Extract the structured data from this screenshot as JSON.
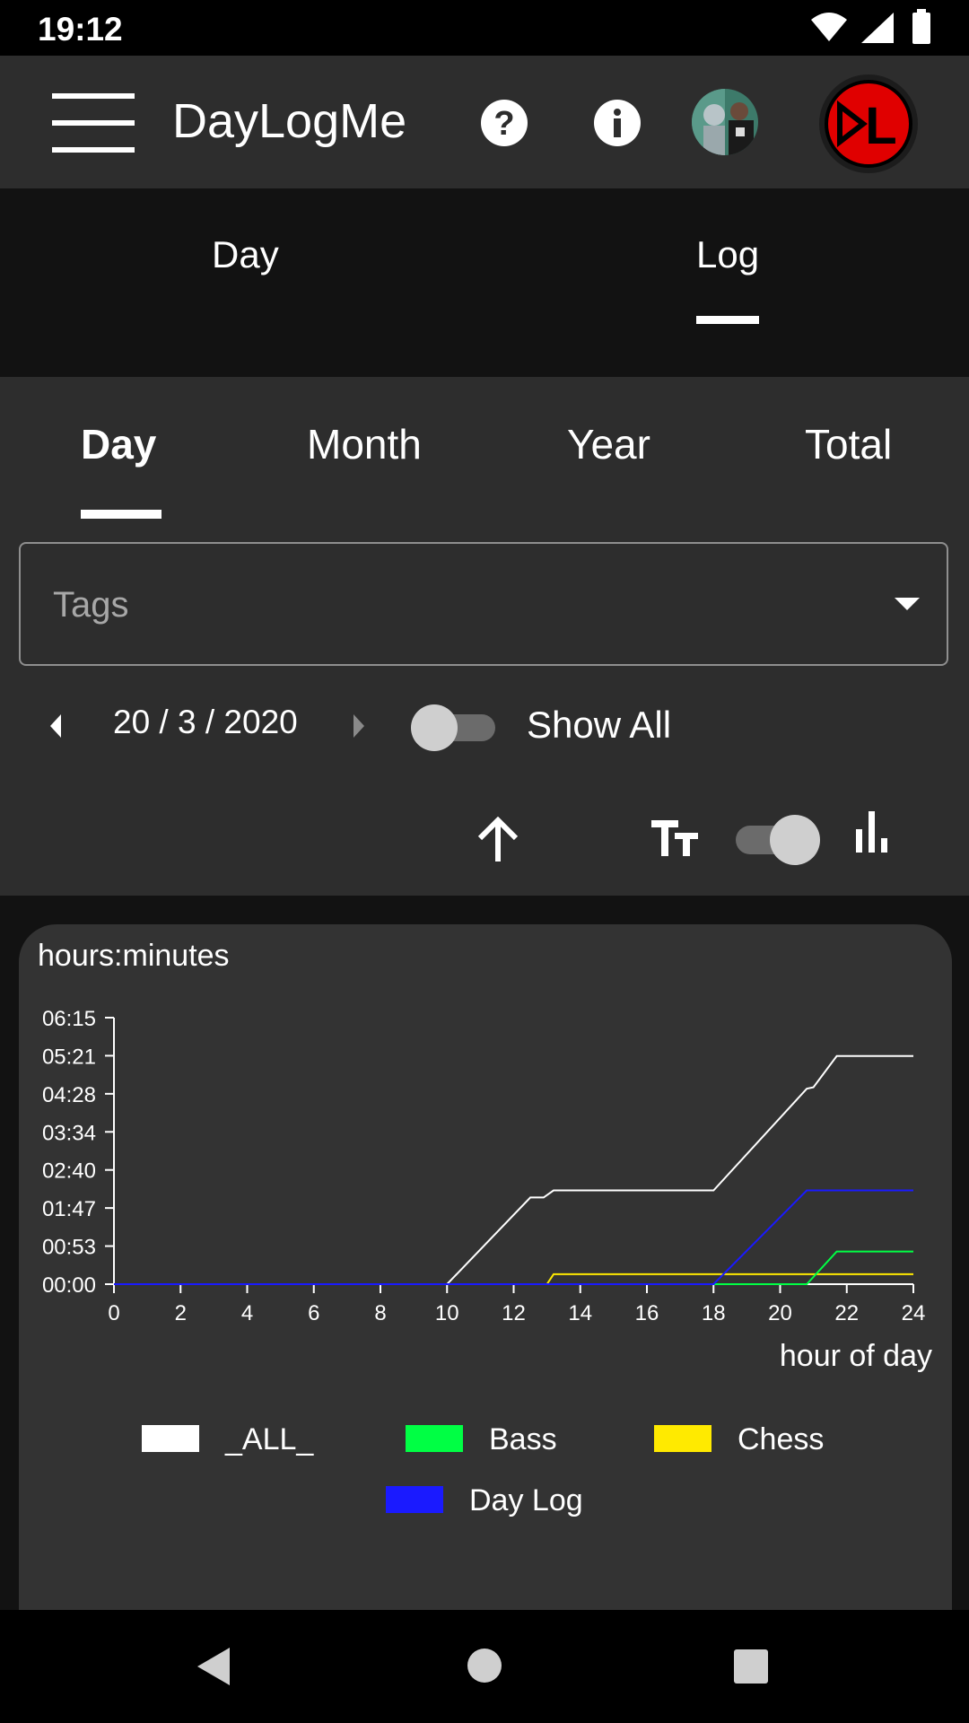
{
  "status_bar": {
    "time": "19:12"
  },
  "app_bar": {
    "title": "DayLogMe"
  },
  "main_tabs": [
    {
      "label": "Day"
    },
    {
      "label": "Log"
    }
  ],
  "sub_tabs": [
    {
      "label": "Day"
    },
    {
      "label": "Month"
    },
    {
      "label": "Year"
    },
    {
      "label": "Total"
    }
  ],
  "tags": {
    "placeholder": "Tags"
  },
  "date_nav": {
    "date": "20 / 3 / 2020"
  },
  "show_all": {
    "label": "Show All",
    "on": false
  },
  "toolbar": {
    "text_size_toggle_on": true
  },
  "chart_data": {
    "type": "line",
    "ylabel": "hours:minutes",
    "xlabel": "hour of day",
    "x_ticks": [
      0,
      2,
      4,
      6,
      8,
      10,
      12,
      14,
      16,
      18,
      20,
      22,
      24
    ],
    "y_tick_labels": [
      "00:00",
      "00:53",
      "01:47",
      "02:40",
      "03:34",
      "04:28",
      "05:21",
      "06:15"
    ],
    "xlim": [
      0,
      24
    ],
    "ylim_minutes": [
      0,
      375
    ],
    "legend_position": "bottom",
    "series": [
      {
        "name": "_ALL_",
        "color": "#ffffff",
        "points": [
          [
            0,
            0
          ],
          [
            10,
            0
          ],
          [
            12.5,
            122
          ],
          [
            12.9,
            122
          ],
          [
            13.2,
            132
          ],
          [
            18,
            132
          ],
          [
            20.8,
            275
          ],
          [
            21,
            277
          ],
          [
            21.7,
            321
          ],
          [
            24,
            321
          ]
        ]
      },
      {
        "name": "Bass",
        "color": "#00ff44",
        "points": [
          [
            0,
            0
          ],
          [
            20.8,
            0
          ],
          [
            21.7,
            46
          ],
          [
            24,
            46
          ]
        ]
      },
      {
        "name": "Chess",
        "color": "#ffea00",
        "points": [
          [
            0,
            0
          ],
          [
            13,
            0
          ],
          [
            13.2,
            14
          ],
          [
            24,
            14
          ]
        ]
      },
      {
        "name": "Day Log",
        "color": "#1a1aff",
        "points": [
          [
            0,
            0
          ],
          [
            18,
            0
          ],
          [
            20.8,
            132
          ],
          [
            24,
            132
          ]
        ]
      }
    ]
  }
}
